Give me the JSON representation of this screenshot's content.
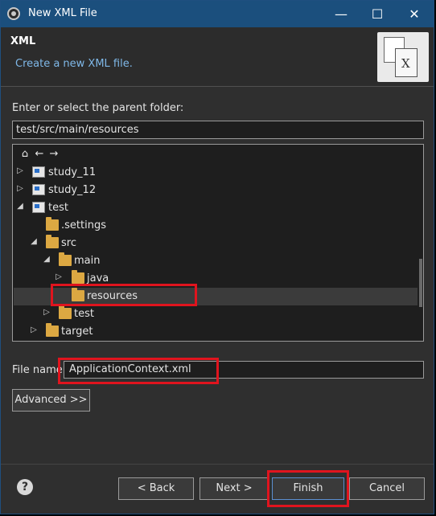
{
  "window": {
    "title": "New XML File"
  },
  "header": {
    "title": "XML",
    "description": "Create a new XML file."
  },
  "folder": {
    "label": "Enter or select the parent folder:",
    "path": "test/src/main/resources"
  },
  "tree": {
    "tools": [
      "⌂",
      "←",
      "→"
    ],
    "items": [
      {
        "label": "study_11",
        "icon": "java-project-icon",
        "twisty": "▷",
        "selected": false
      },
      {
        "label": "study_12",
        "icon": "java-project-icon",
        "twisty": "▷",
        "selected": false
      },
      {
        "label": "test",
        "icon": "java-project-icon",
        "twisty": "◢",
        "selected": false
      },
      {
        "label": ".settings",
        "icon": "folder-icon",
        "twisty": "",
        "selected": false
      },
      {
        "label": "src",
        "icon": "folder-icon",
        "twisty": "◢",
        "selected": false
      },
      {
        "label": "main",
        "icon": "folder-icon",
        "twisty": "◢",
        "selected": false
      },
      {
        "label": "java",
        "icon": "folder-icon",
        "twisty": "▷",
        "selected": false
      },
      {
        "label": "resources",
        "icon": "folder-icon",
        "twisty": "",
        "selected": true
      },
      {
        "label": "test",
        "icon": "folder-icon",
        "twisty": "▷",
        "selected": false
      },
      {
        "label": "target",
        "icon": "folder-icon",
        "twisty": "▷",
        "selected": false
      }
    ]
  },
  "file": {
    "label": "File name:",
    "value": "ApplicationContext.xml"
  },
  "buttons": {
    "advanced": "Advanced >>",
    "back": "< Back",
    "next": "Next >",
    "finish": "Finish",
    "cancel": "Cancel"
  },
  "colors": {
    "highlight": "#e0141e",
    "titlebar": "#1b4f7d",
    "description": "#7fb8e8"
  }
}
